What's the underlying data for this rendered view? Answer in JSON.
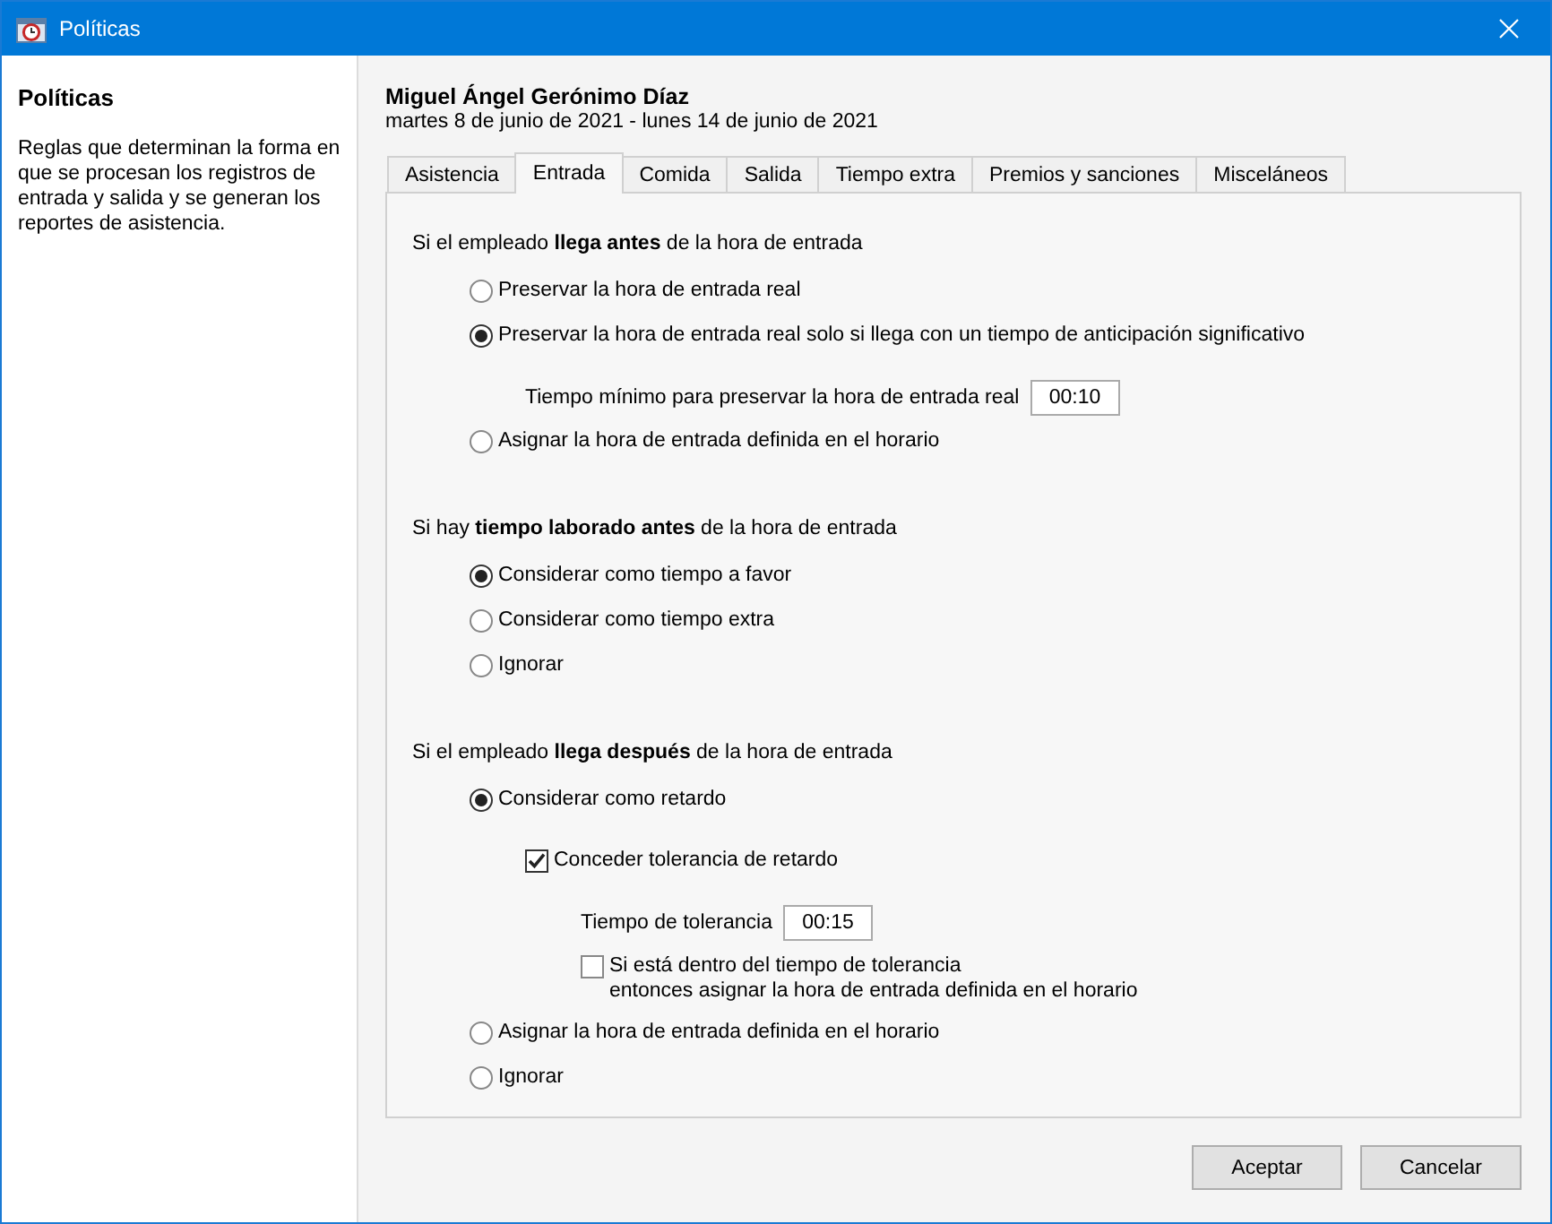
{
  "window": {
    "title": "Políticas"
  },
  "sidebar": {
    "title": "Políticas",
    "description": "Reglas que determinan la forma en que se procesan los registros de entrada y salida y se generan los reportes de asistencia."
  },
  "header": {
    "employee": "Miguel Ángel Gerónimo Díaz",
    "period": "martes 8 de junio de 2021 - lunes 14 de junio de 2021"
  },
  "tabs": [
    {
      "label": "Asistencia",
      "selected": false
    },
    {
      "label": "Entrada",
      "selected": true
    },
    {
      "label": "Comida",
      "selected": false
    },
    {
      "label": "Salida",
      "selected": false
    },
    {
      "label": "Tiempo extra",
      "selected": false
    },
    {
      "label": "Premios y sanciones",
      "selected": false
    },
    {
      "label": "Misceláneos",
      "selected": false
    }
  ],
  "sections": [
    {
      "heading": "Si el empleado **llega antes** de la hora de entrada",
      "options": [
        {
          "kind": "radio",
          "label": "Preservar la hora de entrada real",
          "selected": false
        },
        {
          "kind": "radio",
          "label": "Preservar la hora de entrada real solo si llega con un tiempo de anticipación significativo",
          "selected": true,
          "children": [
            {
              "kind": "field",
              "label": "Tiempo mínimo para preservar la hora de entrada real",
              "value": "00:10"
            }
          ]
        },
        {
          "kind": "radio",
          "label": "Asignar la hora de entrada definida en el horario",
          "selected": false
        }
      ]
    },
    {
      "heading": "Si hay **tiempo laborado antes** de la hora de entrada",
      "options": [
        {
          "kind": "radio",
          "label": "Considerar como tiempo a favor",
          "selected": true
        },
        {
          "kind": "radio",
          "label": "Considerar como tiempo extra",
          "selected": false
        },
        {
          "kind": "radio",
          "label": "Ignorar",
          "selected": false
        }
      ]
    },
    {
      "heading": "Si el empleado **llega después** de la hora de entrada",
      "options": [
        {
          "kind": "radio",
          "label": "Considerar como retardo",
          "selected": true,
          "children": [
            {
              "kind": "checkbox",
              "label": "Conceder tolerancia de retardo",
              "checked": true,
              "children": [
                {
                  "kind": "field",
                  "label": "Tiempo de tolerancia",
                  "value": "00:15"
                },
                {
                  "kind": "checkbox",
                  "label": "Si está dentro del tiempo de tolerancia\nentonces asignar la hora de entrada definida en el horario",
                  "checked": false
                }
              ]
            }
          ]
        },
        {
          "kind": "radio",
          "label": "Asignar la hora de entrada definida en el horario",
          "selected": false
        },
        {
          "kind": "radio",
          "label": "Ignorar",
          "selected": false
        }
      ]
    }
  ],
  "buttons": [
    "Aceptar",
    "Cancelar"
  ]
}
